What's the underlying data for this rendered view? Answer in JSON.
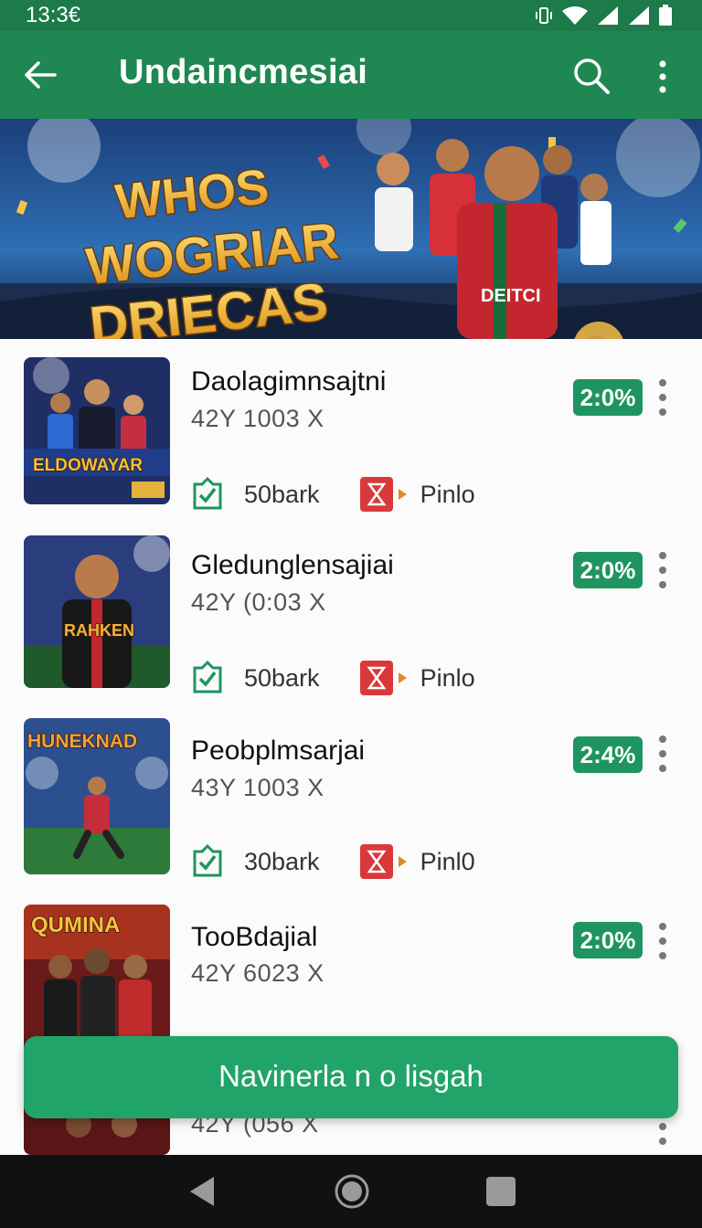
{
  "status": {
    "time": "13:3€"
  },
  "appbar": {
    "title": "Undaincmesiai",
    "back_icon": "arrow-left-icon",
    "search_icon": "search-icon",
    "more_icon": "more-vert-icon"
  },
  "banner": {
    "line1": "WHOS",
    "line2": "WOGRIAR",
    "line3": "DRIECAS",
    "jersey_text": "DEITCI"
  },
  "items": [
    {
      "name": "Daolagimnsajtni",
      "sub": "42Y 1003 X",
      "badge": "2:0%",
      "stat1": "50bark",
      "stat2": "Pinlo",
      "thumb_text": "ELDOWAYAR"
    },
    {
      "name": "Gledunglensajiai",
      "sub": "42Y (0:03 X",
      "badge": "2:0%",
      "stat1": "50bark",
      "stat2": "Pinlo",
      "thumb_text": "RAHKEN"
    },
    {
      "name": "Peobplmsarjai",
      "sub": "43Y 1003 X",
      "badge": "2:4%",
      "stat1": "30bark",
      "stat2": "Pinl0",
      "thumb_text": "HUNEKNAD"
    },
    {
      "name": "TooBdajial",
      "sub": "42Y 6023 X",
      "badge": "2:0%",
      "stat1": "",
      "stat2": "",
      "thumb_text": "QUMINA"
    },
    {
      "name": "",
      "sub": "42Y (056 X",
      "badge": "",
      "stat1": "",
      "stat2": "",
      "thumb_text": ""
    }
  ],
  "cta": {
    "label": "Navinerla n o lisgah"
  },
  "colors": {
    "primary": "#1f8752",
    "accent": "#21a46a",
    "badge": "#1e9560"
  }
}
